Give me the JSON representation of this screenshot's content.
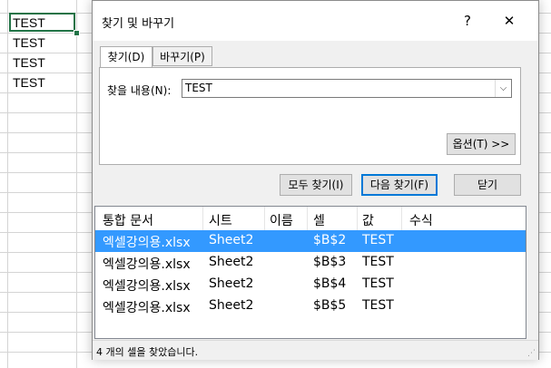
{
  "sheet": {
    "cells": [
      "TEST",
      "TEST",
      "TEST",
      "TEST"
    ]
  },
  "dialog": {
    "title": "찾기 및 바꾸기",
    "help_glyph": "?",
    "close_glyph": "✕",
    "tabs": [
      {
        "label": "찾기(D)"
      },
      {
        "label": "바꾸기(P)"
      }
    ],
    "find_label": "찾을 내용(N):",
    "find_value": "TEST",
    "combo_arrow_glyph": "⌵",
    "options_button": "옵션(T) >>",
    "find_all_button": "모두 찾기(I)",
    "find_next_button": "다음 찾기(F)",
    "close_button": "닫기"
  },
  "results": {
    "columns": [
      "통합 문서",
      "시트",
      "이름",
      "셀",
      "값",
      "수식"
    ],
    "rows": [
      {
        "workbook": "엑셀강의용.xlsx",
        "sheet": "Sheet2",
        "name": "",
        "cell": "$B$2",
        "value": "TEST",
        "formula": ""
      },
      {
        "workbook": "엑셀강의용.xlsx",
        "sheet": "Sheet2",
        "name": "",
        "cell": "$B$3",
        "value": "TEST",
        "formula": ""
      },
      {
        "workbook": "엑셀강의용.xlsx",
        "sheet": "Sheet2",
        "name": "",
        "cell": "$B$4",
        "value": "TEST",
        "formula": ""
      },
      {
        "workbook": "엑셀강의용.xlsx",
        "sheet": "Sheet2",
        "name": "",
        "cell": "$B$5",
        "value": "TEST",
        "formula": ""
      }
    ],
    "selected_index": 0
  },
  "status": {
    "text": "4 개의 셀을 찾았습니다.",
    "grip_glyph": "⋰"
  },
  "colors": {
    "selection": "#3399ff",
    "active_cell_border": "#217346",
    "default_button_border": "#0078d7"
  }
}
